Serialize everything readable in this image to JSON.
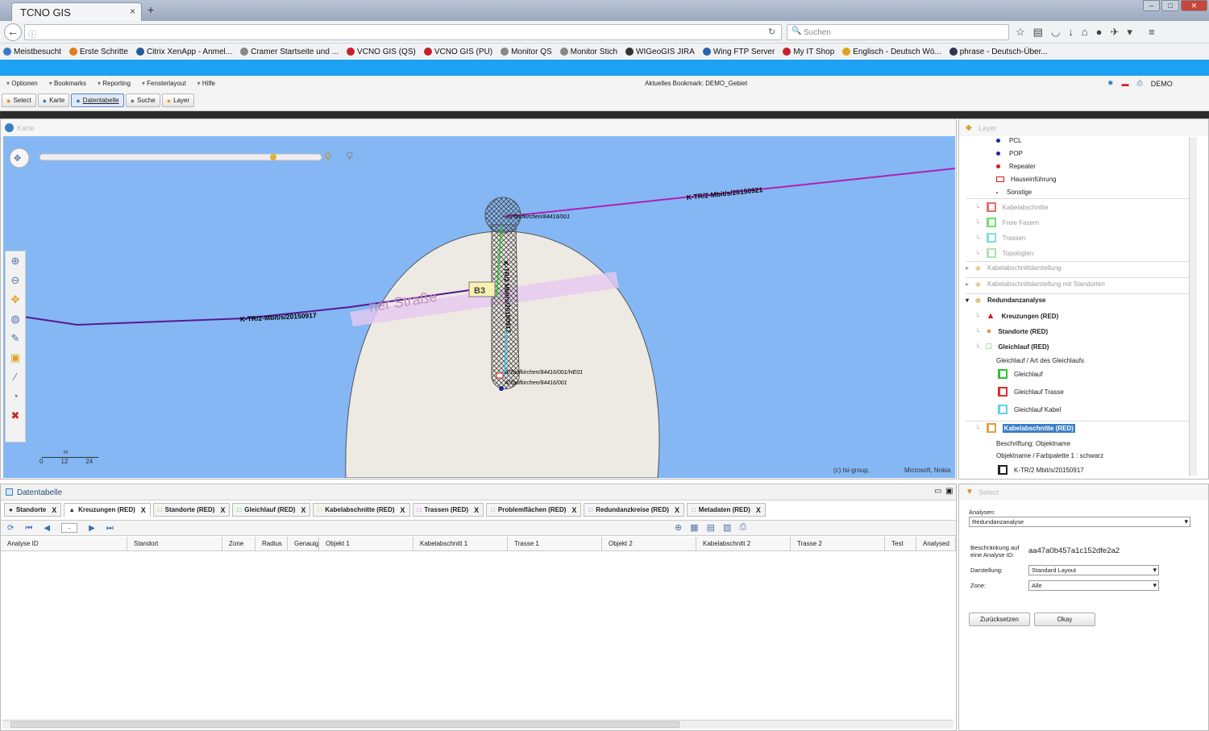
{
  "browser": {
    "tab_title": "TCNO GIS",
    "tab_close": "×",
    "new_tab": "+",
    "search_placeholder": "Suchen",
    "bookmarks": [
      {
        "label": "Meistbesucht",
        "color": "#3a78c8"
      },
      {
        "label": "Erste Schritte",
        "color": "#e07b1e"
      },
      {
        "label": "Citrix XenApp - Anmel...",
        "color": "#225c97"
      },
      {
        "label": "Cramer Startseite und ...",
        "color": "#888888"
      },
      {
        "label": "VCNO GIS (QS)",
        "color": "#c8202a"
      },
      {
        "label": "VCNO GIS (PU)",
        "color": "#c8202a"
      },
      {
        "label": "Monitor QS",
        "color": "#888888"
      },
      {
        "label": "Monitor Stich",
        "color": "#888888"
      },
      {
        "label": "WIGeoGIS JIRA",
        "color": "#333333"
      },
      {
        "label": "Wing FTP Server",
        "color": "#2a64a8"
      },
      {
        "label": "My IT Shop",
        "color": "#c8202a"
      },
      {
        "label": "Englisch - Deutsch Wö...",
        "color": "#e0a21e"
      },
      {
        "label": "phrase - Deutsch-Über...",
        "color": "#333355"
      }
    ]
  },
  "app": {
    "menu": [
      "Optionen",
      "Bookmarks",
      "Reporting",
      "Fensterlayout",
      "Hilfe"
    ],
    "bookmark_label": "Aktuelles Bookmark: DEMO_Gebiet",
    "user": "DEMO",
    "toolbar": [
      {
        "label": "Select",
        "icon": "funnel-icon",
        "color": "#e08a1e"
      },
      {
        "label": "Karte",
        "icon": "globe-icon",
        "color": "#3a7fc5"
      },
      {
        "label": "Datentabelle",
        "icon": "table-icon",
        "color": "#3a7fc5",
        "active": true
      },
      {
        "label": "Suche",
        "icon": "search-icon",
        "color": "#777777"
      },
      {
        "label": "Layer",
        "icon": "layer-icon",
        "color": "#e0a21e"
      }
    ]
  },
  "map": {
    "title": "Karte",
    "labels": {
      "cable_right": "K-TR/2-Mbit/s/20150921",
      "cable_left": "K-TR/2-Mbit/s/20150917",
      "cable_vertical": "K-TR/2 Mbit/s/20150917",
      "site_top": "C/Taufkirchen/84416/001",
      "site_bottom1": "A/Taufkirchen/84416/001/HE01",
      "site_bottom2": "A/Taufkirchen/84416/001",
      "street": "her Straße",
      "road_badge": "B3"
    },
    "scale": {
      "unit": "M",
      "ticks": [
        "0",
        "12",
        "24"
      ]
    },
    "copyright_left": "(c) tsi-group,",
    "copyright_right": "Microsoft, Nokia"
  },
  "layers": {
    "title": "Layer",
    "points": [
      {
        "label": "PCL",
        "color": "#1a2a9a"
      },
      {
        "label": "POP",
        "color": "#1a2a9a"
      },
      {
        "label": "Repeater",
        "color": "#d01c1c"
      },
      {
        "label": "Hauseinführung",
        "color": "#d01c1c"
      },
      {
        "label": "Sonstige",
        "color": "#d01c1c"
      }
    ],
    "grey_items": [
      {
        "label": "Kabelabschnitte",
        "color": "#e07070"
      },
      {
        "label": "Freie Fasern",
        "color": "#70e070"
      },
      {
        "label": "Trassen",
        "color": "#80e0d0"
      },
      {
        "label": "Topologien",
        "color": "#b0e0b0"
      }
    ],
    "groups": [
      "Kabelabschnittdarstellung",
      "Kabelabschnittdarstellung mit Standorten"
    ],
    "redundancy": {
      "label": "Redundanzanalyse",
      "items": [
        "Kreuzungen (RED)",
        "Standorte (RED)",
        "Gleichlauf (RED)"
      ],
      "legend_title": "Gleichlauf / Art des Gleichlaufs",
      "legend": [
        {
          "label": "Gleichlauf",
          "color": "#2ec22e"
        },
        {
          "label": "Gleichlauf Trasse",
          "color": "#d83030"
        },
        {
          "label": "Gleichlauf Kabel",
          "color": "#60d0e8"
        }
      ],
      "kabel_label": "Kabelabschnitte (RED)",
      "beschriftung": "Beschriftung: Objektname",
      "palette": "Objektname / Farbpalette 1 : schwarz",
      "kabel_item": "K-TR/2 Mbit/s/20150917"
    }
  },
  "datatable": {
    "title": "Datentabelle",
    "tabs": [
      {
        "label": "Standorte",
        "color": "#333333"
      },
      {
        "label": "Kreuzungen (RED)",
        "color": "#333333",
        "active": true
      },
      {
        "label": "Standorte (RED)",
        "color": "#c8a040"
      },
      {
        "label": "Gleichlauf (RED)",
        "color": "#2ec22e"
      },
      {
        "label": "Kabelabschnitte (RED)",
        "color": "#e0a040"
      },
      {
        "label": "Trassen (RED)",
        "color": "#c050c0"
      },
      {
        "label": "Problemflächen (RED)",
        "color": "#999999"
      },
      {
        "label": "Redundanzkreise (RED)",
        "color": "#7090d0"
      },
      {
        "label": "Metadaten (RED)",
        "color": "#999999"
      }
    ],
    "tab_close": "X",
    "page": "-",
    "columns": [
      {
        "label": "Analyse ID",
        "w": 157
      },
      {
        "label": "Standort",
        "w": 118
      },
      {
        "label": "Zone",
        "w": 41
      },
      {
        "label": "Radius",
        "w": 40
      },
      {
        "label": "Genauig",
        "w": 39
      },
      {
        "label": "Objekt 1",
        "w": 117
      },
      {
        "label": "Kabelabschnitt 1",
        "w": 117
      },
      {
        "label": "Trasse 1",
        "w": 117
      },
      {
        "label": "Objekt 2",
        "w": 117
      },
      {
        "label": "Kabelabschnitt 2",
        "w": 117
      },
      {
        "label": "Trasse 2",
        "w": 117
      },
      {
        "label": "Test",
        "w": 39
      },
      {
        "label": "Analysed",
        "w": 49
      }
    ]
  },
  "select": {
    "title": "Select",
    "analysen_label": "Analysen:",
    "analysen_value": "Redundanzanalyse",
    "restrict_label": "Beschränkung auf eine Analyse ID:",
    "restrict_value": "aa47a0b457a1c152dfe2a2",
    "darstellung_label": "Darstellung:",
    "darstellung_value": "Standard Layout",
    "zone_label": "Zone:",
    "zone_value": "Alle",
    "reset_label": "Zurücksetzen",
    "ok_label": "Okay"
  }
}
